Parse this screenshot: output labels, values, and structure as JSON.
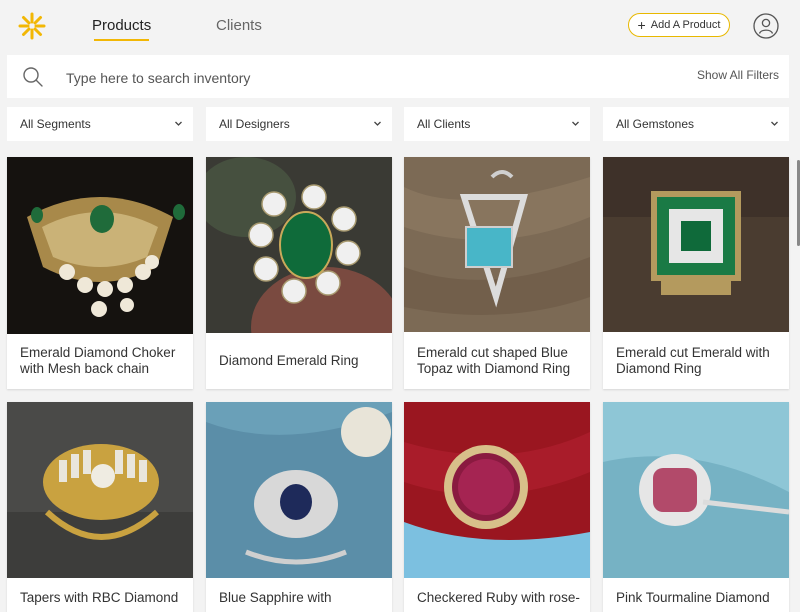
{
  "header": {
    "logo_icon": "sunburst-logo-icon",
    "tabs": [
      {
        "label": "Products",
        "active": true
      },
      {
        "label": "Clients",
        "active": false
      }
    ],
    "add_button": {
      "label": "Add A Product",
      "icon": "plus-icon"
    },
    "user_icon": "user-avatar-icon",
    "accent_color": "#f2b705"
  },
  "search": {
    "placeholder": "Type here to search inventory",
    "value": "",
    "icon": "search-icon",
    "filters_label": "Show All Filters"
  },
  "filters": [
    {
      "label": "All Segments"
    },
    {
      "label": "All Designers"
    },
    {
      "label": "All Clients"
    },
    {
      "label": "All Gemstones"
    }
  ],
  "products": [
    {
      "title": "Emerald Diamond Choker with Mesh back chain"
    },
    {
      "title": "Diamond Emerald Ring"
    },
    {
      "title": "Emerald cut shaped Blue Topaz with Diamond Ring"
    },
    {
      "title": "Emerald cut Emerald with Diamond Ring"
    },
    {
      "title": "Tapers with RBC Diamond"
    },
    {
      "title": "Blue Sapphire with"
    },
    {
      "title": "Checkered Ruby with rose-"
    },
    {
      "title": "Pink Tourmaline Diamond"
    }
  ]
}
